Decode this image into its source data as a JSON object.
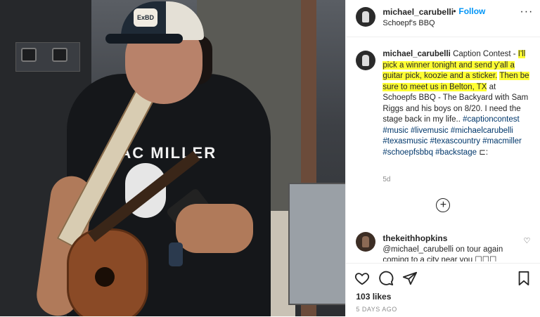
{
  "header": {
    "username": "michael_carubelli",
    "separator": "•",
    "follow_label": "Follow",
    "location": "Schoepf's BBQ",
    "more_label": "···"
  },
  "photo": {
    "cap_patch_text": "ExBD",
    "shirt_logo_text": "MAC MILLER"
  },
  "caption": {
    "username": "michael_carubelli",
    "intro": " Caption Contest - ",
    "highlight_1": "I'll pick a winner tonight and send y'all a guitar pick, koozie and a sticker.",
    "highlight_2": "Then be sure to meet us in Belton, TX",
    "body": " at Schoepfs BBQ - The Backyard with Sam Riggs and his boys on 8/20. I need the stage back in my life.. ",
    "hashtags": "#captioncontest #music #livemusic #michaelcarubelli #texasmusic #texascountry #macmiller #schoepfsbbq #backstage",
    "trail": " ⊏:",
    "time_ago": "5d"
  },
  "load_more": {
    "label": "+"
  },
  "comment": {
    "username": "thekeithhopkins",
    "text": "@michael_carubelli on tour again coming to a city near you ☐☐☐"
  },
  "actions": {
    "likes": "103 likes",
    "date": "5 DAYS AGO"
  }
}
